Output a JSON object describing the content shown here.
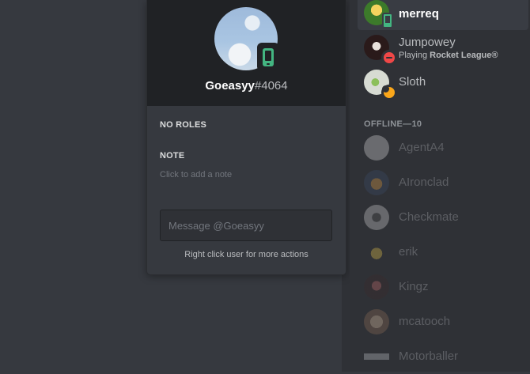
{
  "profile": {
    "username": "Goeasyy",
    "discriminator": "#4064",
    "status_icon": "mobile-phone-icon",
    "roles_label": "NO ROLES",
    "note_label": "NOTE",
    "note_placeholder": "Click to add a note",
    "message_placeholder": "Message @Goeasyy",
    "hint": "Right click user for more actions"
  },
  "members": {
    "online": [
      {
        "name": "merreq",
        "status": "online-mobile",
        "selected": true,
        "avatar_color": "#5a8f3a"
      },
      {
        "name": "Jumpowey",
        "status": "dnd",
        "activity_prefix": "Playing ",
        "activity_game": "Rocket League®",
        "avatar_color": "#4b2a2a"
      },
      {
        "name": "Sloth",
        "status": "idle",
        "avatar_color": "#c8ccc4"
      }
    ],
    "offline_header": "OFFLINE—10",
    "offline": [
      {
        "name": "AgentA4",
        "avatar_color": "#d9d9d9"
      },
      {
        "name": "AIronclad",
        "avatar_color": "#c98a3a"
      },
      {
        "name": "Checkmate",
        "avatar_color": "#cfcfcf"
      },
      {
        "name": "erik",
        "avatar_color": "#c9a23a"
      },
      {
        "name": "Kingz",
        "avatar_color": "#7a4a4a"
      },
      {
        "name": "mcatooch",
        "avatar_color": "#b88a6a"
      },
      {
        "name": "Motorballer",
        "avatar_color": "#8e9297"
      }
    ]
  },
  "colors": {
    "online": "#43b581",
    "dnd": "#f04747",
    "idle": "#faa61a",
    "background": "#36393f",
    "sidebar": "#2f3136"
  }
}
